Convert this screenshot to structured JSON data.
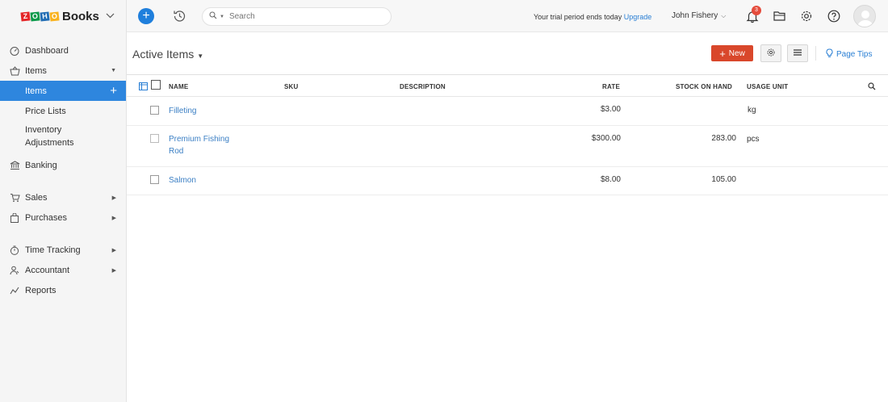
{
  "brand": {
    "logo_letters": [
      "Z",
      "O",
      "H",
      "O"
    ],
    "logo_colors": [
      "#e42527",
      "#089949",
      "#226db4",
      "#f9b21d"
    ],
    "name": "Books"
  },
  "sidebar": {
    "dashboard": "Dashboard",
    "items": "Items",
    "items_sub": "Items",
    "price_lists": "Price Lists",
    "inventory_line1": "Inventory",
    "inventory_line2": "Adjustments",
    "banking": "Banking",
    "sales": "Sales",
    "purchases": "Purchases",
    "time_tracking": "Time Tracking",
    "accountant": "Accountant",
    "reports": "Reports"
  },
  "header": {
    "search_placeholder": "Search",
    "trial_text": "Your trial period ends today",
    "upgrade": "Upgrade",
    "user_name": "John Fishery",
    "notification_count": "3"
  },
  "main": {
    "view_title": "Active Items",
    "new_button": "New",
    "page_tips": "Page Tips"
  },
  "table": {
    "columns": {
      "name": "NAME",
      "sku": "SKU",
      "description": "DESCRIPTION",
      "rate": "RATE",
      "stock": "STOCK ON HAND",
      "unit": "USAGE UNIT"
    },
    "rows": [
      {
        "name": "Filleting",
        "sku": "",
        "description": "",
        "rate": "$3.00",
        "stock": "",
        "unit": "kg"
      },
      {
        "name_line1": "Premium Fishing",
        "name_line2": "Rod",
        "sku": "",
        "description": "",
        "rate": "$300.00",
        "stock": "283.00",
        "unit": "pcs"
      },
      {
        "name": "Salmon",
        "sku": "",
        "description": "",
        "rate": "$8.00",
        "stock": "105.00",
        "unit": ""
      }
    ]
  },
  "colors": {
    "accent": "#2e86de",
    "new_button": "#d9472b",
    "link": "#3b7fc4",
    "badge": "#e54c3c"
  }
}
